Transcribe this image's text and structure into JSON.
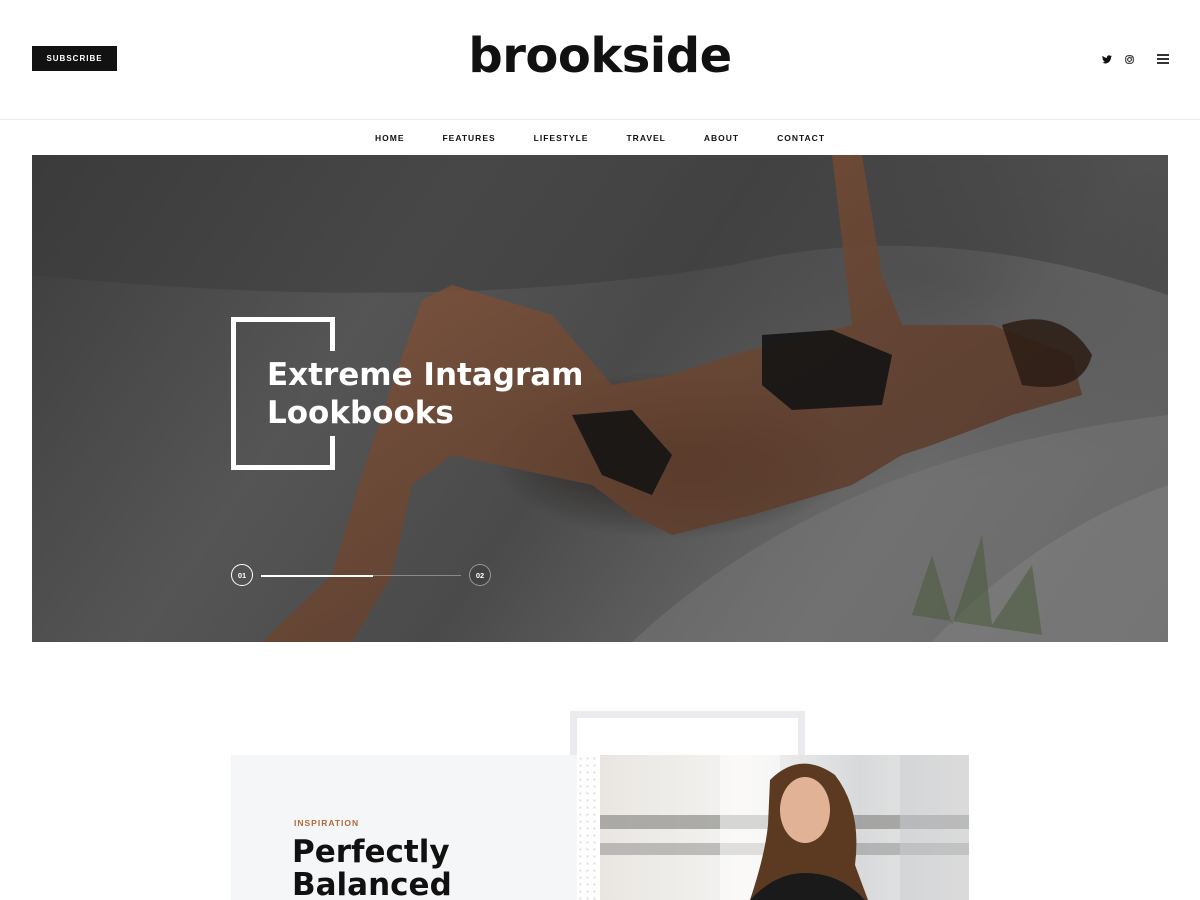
{
  "header": {
    "subscribe_label": "SUBSCRIBE",
    "logo": "brookside",
    "social_icons": [
      "twitter-icon",
      "instagram-icon"
    ],
    "menu_icon": "hamburger-menu-icon"
  },
  "nav": {
    "items": [
      "HOME",
      "FEATURES",
      "LIFESTYLE",
      "TRAVEL",
      "ABOUT",
      "CONTACT"
    ]
  },
  "hero": {
    "title": "Extreme Intagram Lookbooks",
    "slides": [
      "01",
      "02"
    ],
    "active_slide": "01",
    "progress_fraction": 0.56
  },
  "feature": {
    "category": "INSPIRATION",
    "title": "Perfectly Balanced"
  },
  "colors": {
    "accent": "#b06a3b",
    "dark": "#121212",
    "panel": "#f5f6f8",
    "frame": "#ebebef"
  }
}
